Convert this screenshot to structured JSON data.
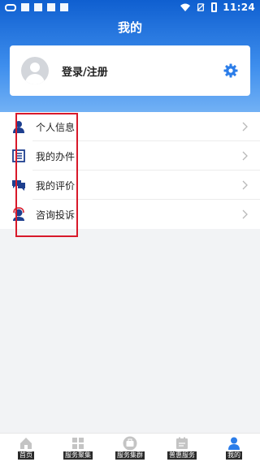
{
  "status_bar": {
    "time": "11:24"
  },
  "header": {
    "title": "我的"
  },
  "profile": {
    "login_label": "登录/注册"
  },
  "menu": {
    "items": [
      {
        "label": "个人信息",
        "icon": "person-icon"
      },
      {
        "label": "我的办件",
        "icon": "document-list-icon"
      },
      {
        "label": "我的评价",
        "icon": "comment-icon"
      },
      {
        "label": "咨询投诉",
        "icon": "service-agent-icon"
      }
    ]
  },
  "tabbar": {
    "items": [
      {
        "label": "首页",
        "icon": "home-icon"
      },
      {
        "label": "服务聚集",
        "icon": "grid-icon"
      },
      {
        "label": "服务集群",
        "icon": "briefcase-icon"
      },
      {
        "label": "普惠服务",
        "icon": "calendar-icon"
      },
      {
        "label": "我的",
        "icon": "person-icon",
        "active": true
      }
    ]
  },
  "colors": {
    "primary": "#2b7de9",
    "header_top": "#0f5fd0",
    "highlight": "#d8192a",
    "icon_navy": "#1e3f8f"
  }
}
